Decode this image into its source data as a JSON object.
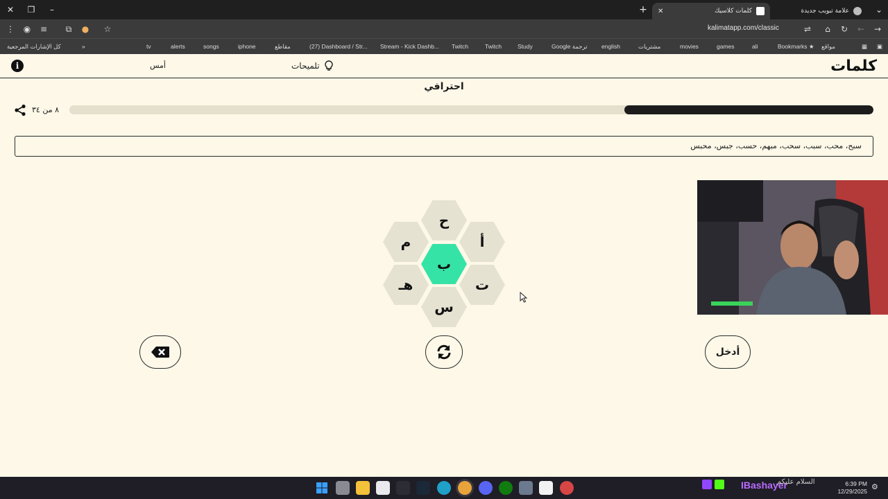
{
  "browser": {
    "tabs": [
      {
        "title": "كلمات كلاسيك",
        "active": true
      },
      {
        "title": "علامة تبويب جديدة",
        "active": false
      }
    ],
    "url": "kalimatapp.com/classic",
    "bookmarks": [
      "Bookmarks",
      "مواقع",
      "ali",
      "games",
      "movies",
      "مشتريات",
      "english",
      "Google ترجمة",
      "Study",
      "Twitch",
      "Twitch",
      "Stream - Kick Dashb...",
      "(27) Dashboard / Str...",
      "مقاطع",
      "iphone",
      "songs",
      "alerts",
      "tv",
      "كل الإشارات المرجعية"
    ]
  },
  "header": {
    "logo": "كلمات",
    "hints": "تلميحات",
    "yesterday": "أمس"
  },
  "game": {
    "level": "احترافي",
    "progress_text": "٨ من ٣٤",
    "progress_fraction": 0.31,
    "found_words": "سبح، محب، سبب، سحب، مبهم، حسب، جبس، محبس",
    "letters": {
      "center": "ب",
      "top": "ح",
      "top_right": "أ",
      "bottom_right": "ت",
      "bottom": "س",
      "bottom_left": "هـ",
      "top_left": "م"
    },
    "enter_label": "أدخل"
  },
  "taskbar": {
    "streamer": "IBashayer",
    "greeting": "السلام عليكم",
    "time": "6:39 PM",
    "date": "12/29/2025"
  },
  "colors": {
    "background": "#fdf8e8",
    "center_hex": "#36e3a6",
    "outer_hex": "#e6e2d1",
    "progress_fill": "#1c1c1c",
    "progress_track": "#e5e0cd"
  }
}
